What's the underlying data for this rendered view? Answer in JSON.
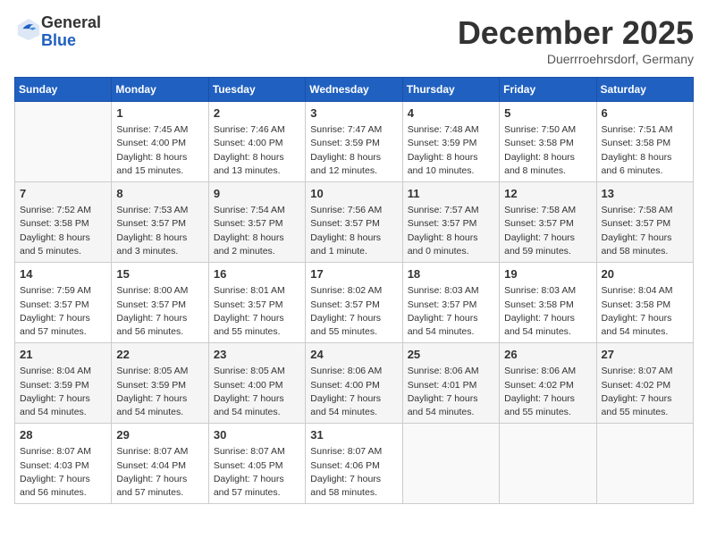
{
  "header": {
    "logo_line1": "General",
    "logo_line2": "Blue",
    "month_title": "December 2025",
    "location": "Duerrroehrsdorf, Germany"
  },
  "weekdays": [
    "Sunday",
    "Monday",
    "Tuesday",
    "Wednesday",
    "Thursday",
    "Friday",
    "Saturday"
  ],
  "weeks": [
    [
      {
        "day": "",
        "sunrise": "",
        "sunset": "",
        "daylight": ""
      },
      {
        "day": "1",
        "sunrise": "Sunrise: 7:45 AM",
        "sunset": "Sunset: 4:00 PM",
        "daylight": "Daylight: 8 hours and 15 minutes."
      },
      {
        "day": "2",
        "sunrise": "Sunrise: 7:46 AM",
        "sunset": "Sunset: 4:00 PM",
        "daylight": "Daylight: 8 hours and 13 minutes."
      },
      {
        "day": "3",
        "sunrise": "Sunrise: 7:47 AM",
        "sunset": "Sunset: 3:59 PM",
        "daylight": "Daylight: 8 hours and 12 minutes."
      },
      {
        "day": "4",
        "sunrise": "Sunrise: 7:48 AM",
        "sunset": "Sunset: 3:59 PM",
        "daylight": "Daylight: 8 hours and 10 minutes."
      },
      {
        "day": "5",
        "sunrise": "Sunrise: 7:50 AM",
        "sunset": "Sunset: 3:58 PM",
        "daylight": "Daylight: 8 hours and 8 minutes."
      },
      {
        "day": "6",
        "sunrise": "Sunrise: 7:51 AM",
        "sunset": "Sunset: 3:58 PM",
        "daylight": "Daylight: 8 hours and 6 minutes."
      }
    ],
    [
      {
        "day": "7",
        "sunrise": "Sunrise: 7:52 AM",
        "sunset": "Sunset: 3:58 PM",
        "daylight": "Daylight: 8 hours and 5 minutes."
      },
      {
        "day": "8",
        "sunrise": "Sunrise: 7:53 AM",
        "sunset": "Sunset: 3:57 PM",
        "daylight": "Daylight: 8 hours and 3 minutes."
      },
      {
        "day": "9",
        "sunrise": "Sunrise: 7:54 AM",
        "sunset": "Sunset: 3:57 PM",
        "daylight": "Daylight: 8 hours and 2 minutes."
      },
      {
        "day": "10",
        "sunrise": "Sunrise: 7:56 AM",
        "sunset": "Sunset: 3:57 PM",
        "daylight": "Daylight: 8 hours and 1 minute."
      },
      {
        "day": "11",
        "sunrise": "Sunrise: 7:57 AM",
        "sunset": "Sunset: 3:57 PM",
        "daylight": "Daylight: 8 hours and 0 minutes."
      },
      {
        "day": "12",
        "sunrise": "Sunrise: 7:58 AM",
        "sunset": "Sunset: 3:57 PM",
        "daylight": "Daylight: 7 hours and 59 minutes."
      },
      {
        "day": "13",
        "sunrise": "Sunrise: 7:58 AM",
        "sunset": "Sunset: 3:57 PM",
        "daylight": "Daylight: 7 hours and 58 minutes."
      }
    ],
    [
      {
        "day": "14",
        "sunrise": "Sunrise: 7:59 AM",
        "sunset": "Sunset: 3:57 PM",
        "daylight": "Daylight: 7 hours and 57 minutes."
      },
      {
        "day": "15",
        "sunrise": "Sunrise: 8:00 AM",
        "sunset": "Sunset: 3:57 PM",
        "daylight": "Daylight: 7 hours and 56 minutes."
      },
      {
        "day": "16",
        "sunrise": "Sunrise: 8:01 AM",
        "sunset": "Sunset: 3:57 PM",
        "daylight": "Daylight: 7 hours and 55 minutes."
      },
      {
        "day": "17",
        "sunrise": "Sunrise: 8:02 AM",
        "sunset": "Sunset: 3:57 PM",
        "daylight": "Daylight: 7 hours and 55 minutes."
      },
      {
        "day": "18",
        "sunrise": "Sunrise: 8:03 AM",
        "sunset": "Sunset: 3:57 PM",
        "daylight": "Daylight: 7 hours and 54 minutes."
      },
      {
        "day": "19",
        "sunrise": "Sunrise: 8:03 AM",
        "sunset": "Sunset: 3:58 PM",
        "daylight": "Daylight: 7 hours and 54 minutes."
      },
      {
        "day": "20",
        "sunrise": "Sunrise: 8:04 AM",
        "sunset": "Sunset: 3:58 PM",
        "daylight": "Daylight: 7 hours and 54 minutes."
      }
    ],
    [
      {
        "day": "21",
        "sunrise": "Sunrise: 8:04 AM",
        "sunset": "Sunset: 3:59 PM",
        "daylight": "Daylight: 7 hours and 54 minutes."
      },
      {
        "day": "22",
        "sunrise": "Sunrise: 8:05 AM",
        "sunset": "Sunset: 3:59 PM",
        "daylight": "Daylight: 7 hours and 54 minutes."
      },
      {
        "day": "23",
        "sunrise": "Sunrise: 8:05 AM",
        "sunset": "Sunset: 4:00 PM",
        "daylight": "Daylight: 7 hours and 54 minutes."
      },
      {
        "day": "24",
        "sunrise": "Sunrise: 8:06 AM",
        "sunset": "Sunset: 4:00 PM",
        "daylight": "Daylight: 7 hours and 54 minutes."
      },
      {
        "day": "25",
        "sunrise": "Sunrise: 8:06 AM",
        "sunset": "Sunset: 4:01 PM",
        "daylight": "Daylight: 7 hours and 54 minutes."
      },
      {
        "day": "26",
        "sunrise": "Sunrise: 8:06 AM",
        "sunset": "Sunset: 4:02 PM",
        "daylight": "Daylight: 7 hours and 55 minutes."
      },
      {
        "day": "27",
        "sunrise": "Sunrise: 8:07 AM",
        "sunset": "Sunset: 4:02 PM",
        "daylight": "Daylight: 7 hours and 55 minutes."
      }
    ],
    [
      {
        "day": "28",
        "sunrise": "Sunrise: 8:07 AM",
        "sunset": "Sunset: 4:03 PM",
        "daylight": "Daylight: 7 hours and 56 minutes."
      },
      {
        "day": "29",
        "sunrise": "Sunrise: 8:07 AM",
        "sunset": "Sunset: 4:04 PM",
        "daylight": "Daylight: 7 hours and 57 minutes."
      },
      {
        "day": "30",
        "sunrise": "Sunrise: 8:07 AM",
        "sunset": "Sunset: 4:05 PM",
        "daylight": "Daylight: 7 hours and 57 minutes."
      },
      {
        "day": "31",
        "sunrise": "Sunrise: 8:07 AM",
        "sunset": "Sunset: 4:06 PM",
        "daylight": "Daylight: 7 hours and 58 minutes."
      },
      {
        "day": "",
        "sunrise": "",
        "sunset": "",
        "daylight": ""
      },
      {
        "day": "",
        "sunrise": "",
        "sunset": "",
        "daylight": ""
      },
      {
        "day": "",
        "sunrise": "",
        "sunset": "",
        "daylight": ""
      }
    ]
  ]
}
